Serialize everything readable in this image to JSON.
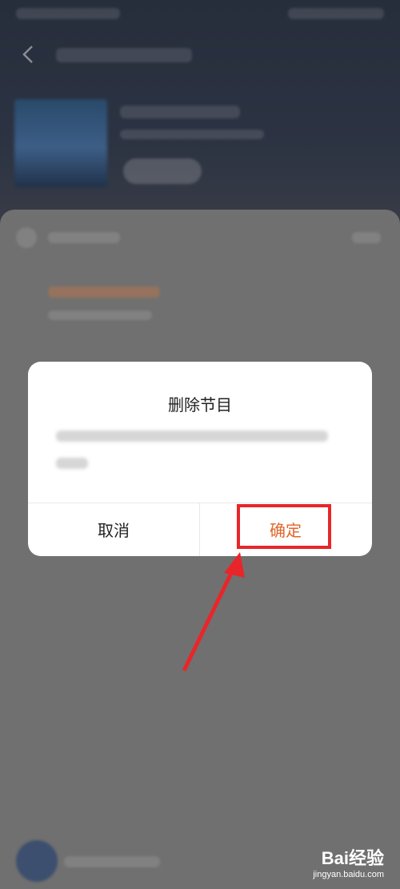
{
  "dialog": {
    "title": "删除节目",
    "cancel_label": "取消",
    "confirm_label": "确定"
  },
  "background": {
    "back_icon": "chevron-left-icon"
  },
  "watermark": {
    "brand": "Bai经验",
    "url": "jingyan.baidu.com"
  },
  "colors": {
    "confirm_text": "#e0662a",
    "highlight": "#e8262a"
  }
}
